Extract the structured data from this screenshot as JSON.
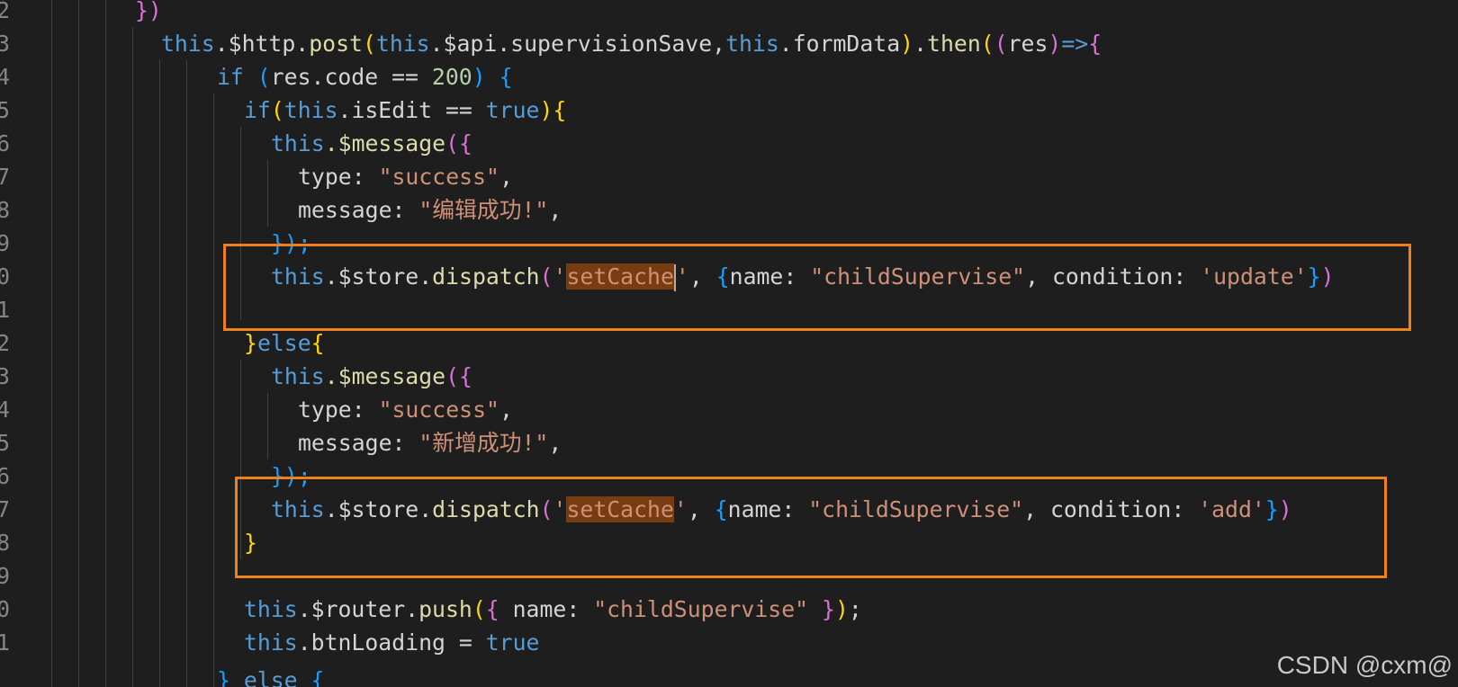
{
  "line_numbers": [
    "2",
    "3",
    "4",
    "5",
    "6",
    "7",
    "8",
    "9",
    "0",
    "1",
    "2",
    "3",
    "4",
    "5",
    "6",
    "7",
    "8",
    "9",
    "0",
    "1"
  ],
  "code": {
    "l1": {
      "close": "})"
    },
    "l2": {
      "this": "this",
      "http": ".$http.",
      "post": "post",
      "this2": "this",
      "api": ".$api.supervisionSave,",
      "this3": "this",
      "form": ".formData",
      "then": "then",
      "res": "res",
      "arrow": "=>"
    },
    "l3": {
      "if": "if",
      "cond": "res.code == ",
      "num": "200",
      "brace": "{"
    },
    "l4": {
      "if": "if",
      "this": "this",
      "edit": ".isEdit == ",
      "true": "true"
    },
    "l5": {
      "this": "this",
      "msg": ".$message",
      "open": "({"
    },
    "l6": {
      "key": "type: ",
      "val": "\"success\"",
      "comma": ","
    },
    "l7": {
      "key": "message: ",
      "val": "\"编辑成功!\"",
      "comma": ","
    },
    "l8": {
      "close": "});"
    },
    "l9": {
      "this": "this",
      "store": ".$store.",
      "dispatch": "dispatch",
      "q1": "'",
      "action": "setCache",
      "q2": "'",
      "mid": ", ",
      "obj_open": "{",
      "name_key": "name: ",
      "name_val": "\"childSupervise\"",
      "sep": ", ",
      "cond_key": "condition: ",
      "cond_val": "'update'",
      "obj_close": "}",
      "paren_close": ")"
    },
    "l11": {
      "close": "}",
      "else": "else",
      "open": "{"
    },
    "l12": {
      "this": "this",
      "msg": ".$message",
      "open": "({"
    },
    "l13": {
      "key": "type: ",
      "val": "\"success\"",
      "comma": ","
    },
    "l14": {
      "key": "message: ",
      "val": "\"新增成功!\"",
      "comma": ","
    },
    "l15": {
      "close": "});"
    },
    "l16": {
      "this": "this",
      "store": ".$store.",
      "dispatch": "dispatch",
      "q1": "'",
      "action": "setCache",
      "q2": "'",
      "mid": ", ",
      "obj_open": "{",
      "name_key": "name: ",
      "name_val": "\"childSupervise\"",
      "sep": ", ",
      "cond_key": "condition: ",
      "cond_val": "'add'",
      "obj_close": "}",
      "paren_close": ")"
    },
    "l17": {
      "close": "}"
    },
    "l19": {
      "this": "this",
      "router": ".$router.",
      "push": "push",
      "name_key": " name: ",
      "name_val": "\"childSupervise\"",
      "end": ";"
    },
    "l20": {
      "this": "this",
      "loading": ".btnLoading = ",
      "true": "true"
    }
  },
  "watermark": "CSDN @cxm@",
  "colors": {
    "background": "#1e1e1e",
    "keyword": "#569cd6",
    "function": "#dcdcaa",
    "string": "#ce9178",
    "number": "#b5cea8",
    "highlight": "#773c10",
    "callout_border": "#f0801a"
  }
}
